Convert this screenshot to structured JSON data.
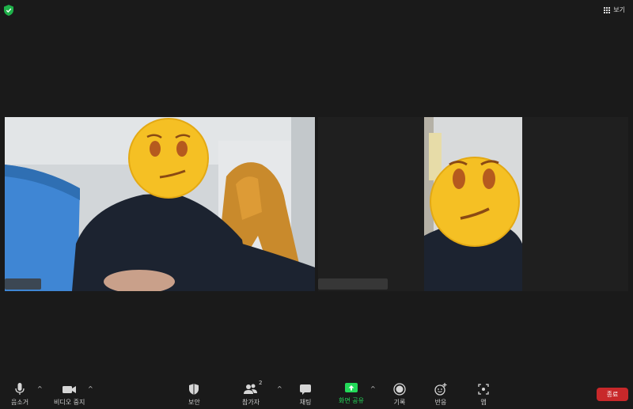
{
  "top": {
    "view_label": "보기"
  },
  "participants": [
    {
      "name": ""
    },
    {
      "name": ""
    }
  ],
  "toolbar": {
    "mute_label": "음소거",
    "video_label": "비디오 중지",
    "security_label": "보안",
    "participants_label": "참가자",
    "participants_count": "2",
    "chat_label": "채팅",
    "share_label": "화면 공유",
    "record_label": "기록",
    "reactions_label": "반응",
    "apps_label": "앱",
    "end_label": "종료"
  },
  "colors": {
    "share_green": "#23d959",
    "end_red": "#c8282a",
    "shield_green": "#1fb14a"
  }
}
